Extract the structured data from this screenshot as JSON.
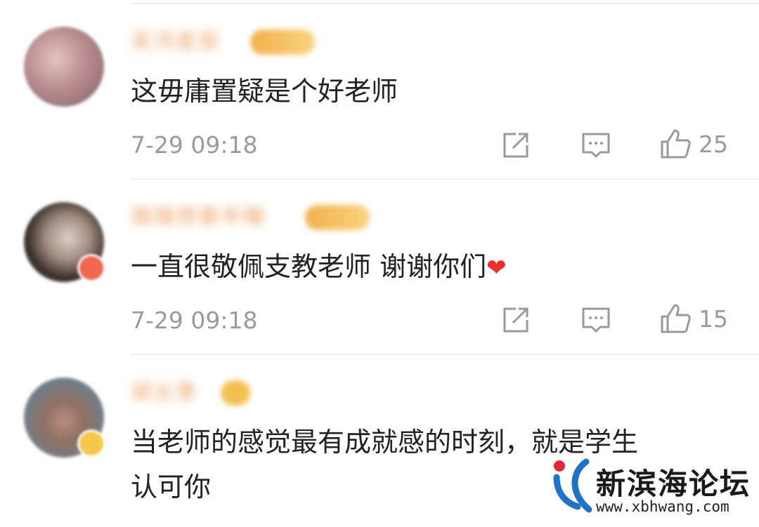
{
  "comments": [
    {
      "username": "吴鸿星辰",
      "text": "这毋庸置疑是个好老师",
      "time": "7-29 09:18",
      "likes": "25"
    },
    {
      "username": "璐璐想要早睡",
      "text": "一直很敬佩支教老师 谢谢你们",
      "emoji": "❤",
      "time": "7-29 09:18",
      "likes": "15"
    },
    {
      "username": "胡云景",
      "text_line1": "当老师的感觉最有成就感的时刻，就是学生",
      "text_line2": "认可你"
    }
  ],
  "icons": {
    "share": "share-icon",
    "reply": "comment-icon",
    "like": "thumbs-up-icon"
  },
  "watermark": {
    "title": "新滨海论坛",
    "url": "www.xbhwang.com"
  },
  "colors": {
    "meta_gray": "#9a9a9a",
    "text": "#222222",
    "logo_blue": "#1e73c8",
    "logo_red": "#e22a3a"
  }
}
